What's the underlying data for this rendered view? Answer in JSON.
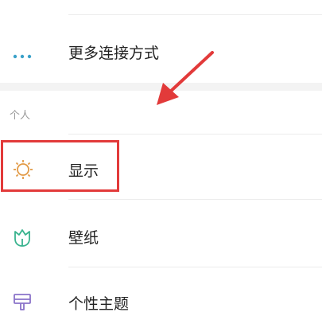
{
  "rows": {
    "more_connect": {
      "label": "更多连接方式",
      "icon": "more-dots-icon"
    },
    "display": {
      "label": "显示",
      "icon": "sun-icon"
    },
    "wallpaper": {
      "label": "壁纸",
      "icon": "tulip-icon"
    },
    "theme": {
      "label": "个性主题",
      "icon": "brush-icon"
    }
  },
  "sections": {
    "personal": "个人"
  },
  "colors": {
    "highlight": "#e23a3a",
    "more_icon": "#3aa1c9",
    "sun_icon": "#e29a46",
    "tulip_icon": "#39b38e",
    "brush_icon": "#8a73c9"
  }
}
